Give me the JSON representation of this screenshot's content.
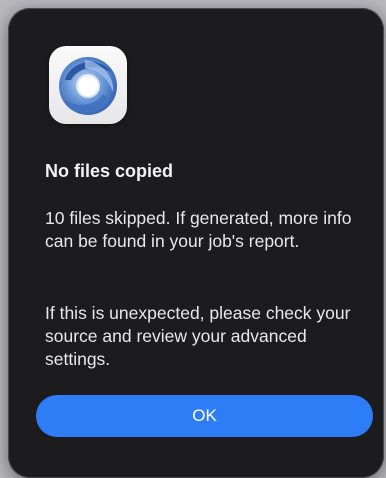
{
  "dialog": {
    "icon": "aperture-swirl-icon",
    "title": "No files copied",
    "message_1": "10 files skipped. If generated, more info can be found in your job's report.",
    "message_2": "If this is unexpected, please check your source and review your advanced settings.",
    "ok_label": "OK"
  },
  "colors": {
    "background": "#1c1c1e",
    "accent": "#2f7df6",
    "text": "#e8e8e8"
  }
}
